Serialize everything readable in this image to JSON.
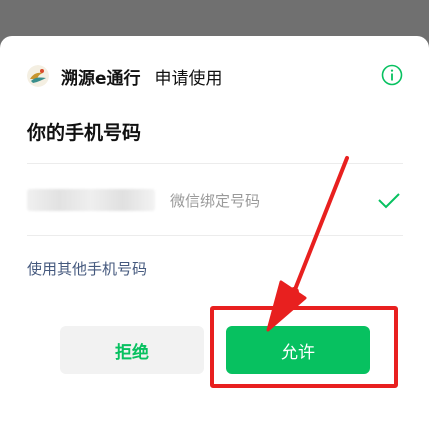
{
  "header": {
    "app_name": "溯源e通行",
    "request_text": "申请使用",
    "info_icon": "info-circle-icon",
    "app_logo_icon": "app-logo-icon"
  },
  "title": "你的手机号码",
  "phone_row": {
    "masked_number": "",
    "label": "微信绑定号码",
    "selected": true,
    "check_icon": "checkmark-icon"
  },
  "other_phone_link": "使用其他手机号码",
  "buttons": {
    "reject": "拒绝",
    "allow": "允许"
  },
  "annotation": {
    "highlight_color": "#e8201f",
    "arrow_icon": "red-arrow-pointer"
  },
  "colors": {
    "accent": "#07c160",
    "link": "#45597e",
    "annotation": "#e8201f"
  }
}
